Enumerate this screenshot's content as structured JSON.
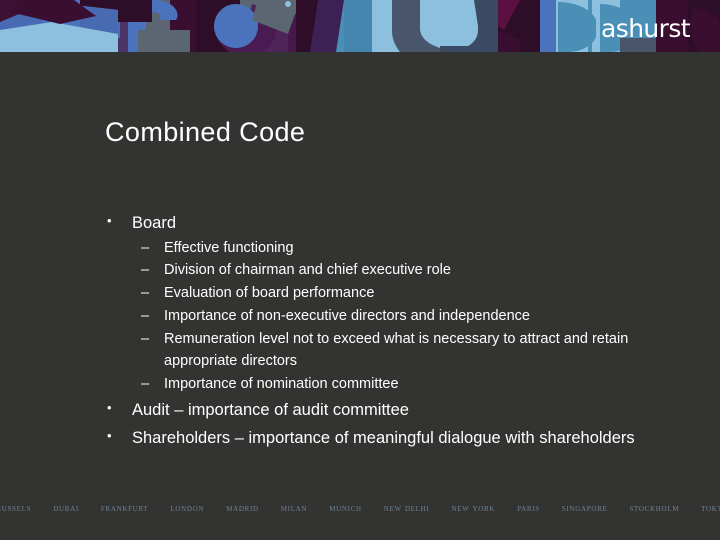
{
  "brand": {
    "logo_text": "ashurst",
    "logo_color": "#ffffff",
    "background_color": "#333331",
    "footer_text_color": "#6f8498",
    "banner_palette": [
      "#3c1135",
      "#4a72bd",
      "#8cc0de",
      "#58606e",
      "#4a8fb5",
      "#2e0d28",
      "#4a3566"
    ]
  },
  "slide": {
    "title": "Combined Code"
  },
  "content": {
    "bullets": [
      {
        "label": "Board",
        "marker": "•",
        "sub_marker": "–",
        "sub_items": [
          "Effective functioning",
          "Division of chairman and chief executive role",
          "Evaluation of board performance",
          "Importance of non-executive directors and independence",
          "Remuneration level not to exceed what is necessary to attract and retain appropriate directors",
          "Importance of nomination committee"
        ]
      },
      {
        "label": "Audit – importance of audit committee",
        "marker": "•",
        "sub_marker": "–",
        "sub_items": []
      },
      {
        "label": "Shareholders – importance of meaningful dialogue with shareholders",
        "marker": "•",
        "sub_marker": "–",
        "sub_items": []
      }
    ]
  },
  "footer": {
    "cities": [
      "Brussels",
      "Dubai",
      "Frankfurt",
      "London",
      "Madrid",
      "Milan",
      "Munich",
      "New Delhi",
      "New York",
      "Paris",
      "Singapore",
      "Stockholm",
      "Tokyo"
    ]
  }
}
